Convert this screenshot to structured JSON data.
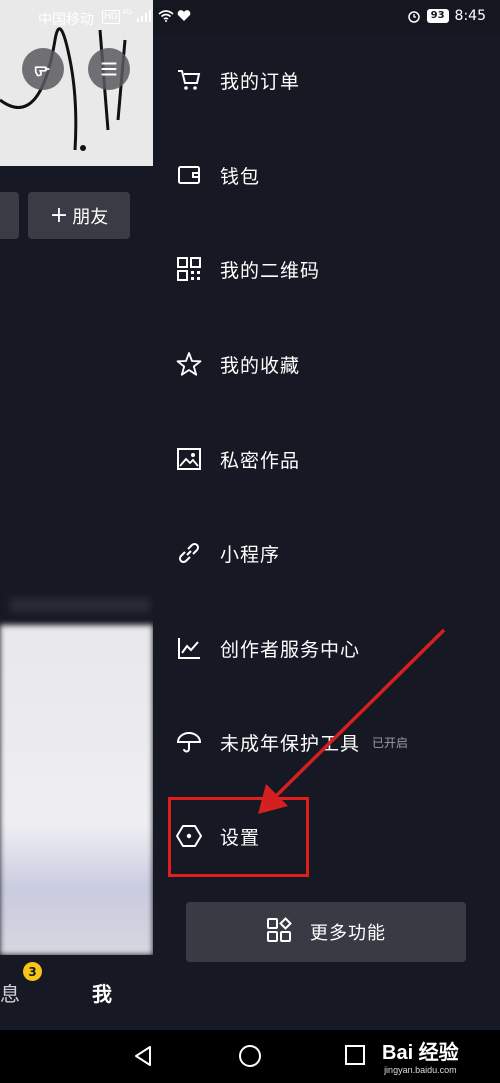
{
  "status_bar": {
    "carrier": "中国移动",
    "hd_badge": "HD",
    "network": "4G",
    "battery": "93",
    "time": "8:45"
  },
  "profile": {
    "add_friend_label": "朋友",
    "tabs": {
      "messages_label": "息",
      "messages_badge": "3",
      "me_label": "我"
    }
  },
  "drawer": {
    "items": [
      {
        "label": "我的订单",
        "icon": "cart-icon"
      },
      {
        "label": "钱包",
        "icon": "wallet-icon"
      },
      {
        "label": "我的二维码",
        "icon": "qr-code-icon"
      },
      {
        "label": "我的收藏",
        "icon": "star-icon"
      },
      {
        "label": "私密作品",
        "icon": "image-icon"
      },
      {
        "label": "小程序",
        "icon": "link-icon"
      },
      {
        "label": "创作者服务中心",
        "icon": "chart-icon"
      },
      {
        "label": "未成年保护工具",
        "icon": "umbrella-icon",
        "sub": "已开启"
      },
      {
        "label": "设置",
        "icon": "hexagon-settings-icon"
      }
    ],
    "more_label": "更多功能"
  },
  "annotation_color": "#e01e1e",
  "watermark": {
    "main": "Bai 经验",
    "sub": "jingyan.baidu.com"
  }
}
